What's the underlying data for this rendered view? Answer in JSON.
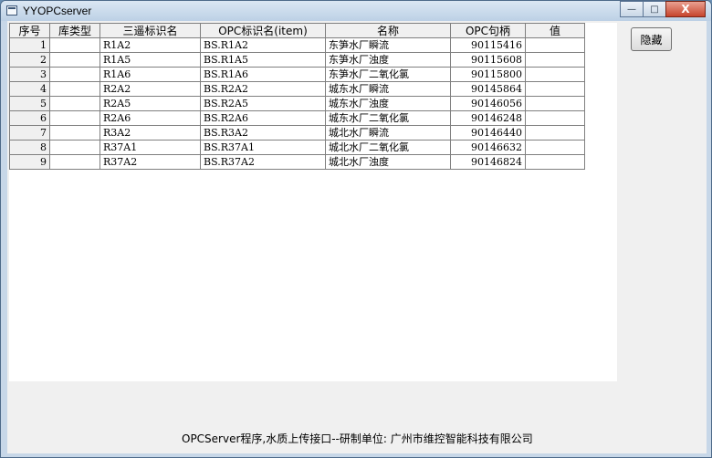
{
  "window": {
    "title": "YYOPCserver",
    "minimize_glyph": "—",
    "maximize_glyph": "□",
    "close_glyph": "X"
  },
  "table": {
    "headers": [
      "序号",
      "库类型",
      "三遥标识名",
      "OPC标识名(item)",
      "名称",
      "OPC句柄",
      "值"
    ],
    "rows": [
      [
        "1",
        "",
        "R1A2",
        "BS.R1A2",
        "东笋水厂瞬流",
        "90115416",
        ""
      ],
      [
        "2",
        "",
        "R1A5",
        "BS.R1A5",
        "东笋水厂浊度",
        "90115608",
        ""
      ],
      [
        "3",
        "",
        "R1A6",
        "BS.R1A6",
        "东笋水厂二氧化氯",
        "90115800",
        ""
      ],
      [
        "4",
        "",
        "R2A2",
        "BS.R2A2",
        "城东水厂瞬流",
        "90145864",
        ""
      ],
      [
        "5",
        "",
        "R2A5",
        "BS.R2A5",
        "城东水厂浊度",
        "90146056",
        ""
      ],
      [
        "6",
        "",
        "R2A6",
        "BS.R2A6",
        "城东水厂二氧化氯",
        "90146248",
        ""
      ],
      [
        "7",
        "",
        "R3A2",
        "BS.R3A2",
        "城北水厂瞬流",
        "90146440",
        ""
      ],
      [
        "8",
        "",
        "R37A1",
        "BS.R37A1",
        "城北水厂二氧化氯",
        "90146632",
        ""
      ],
      [
        "9",
        "",
        "R37A2",
        "BS.R37A2",
        "城北水厂浊度",
        "90146824",
        ""
      ]
    ]
  },
  "buttons": {
    "hide_label": "隐藏"
  },
  "footer": {
    "text": "OPCServer程序,水质上传接口--研制单位: 广州市维控智能科技有限公司"
  }
}
